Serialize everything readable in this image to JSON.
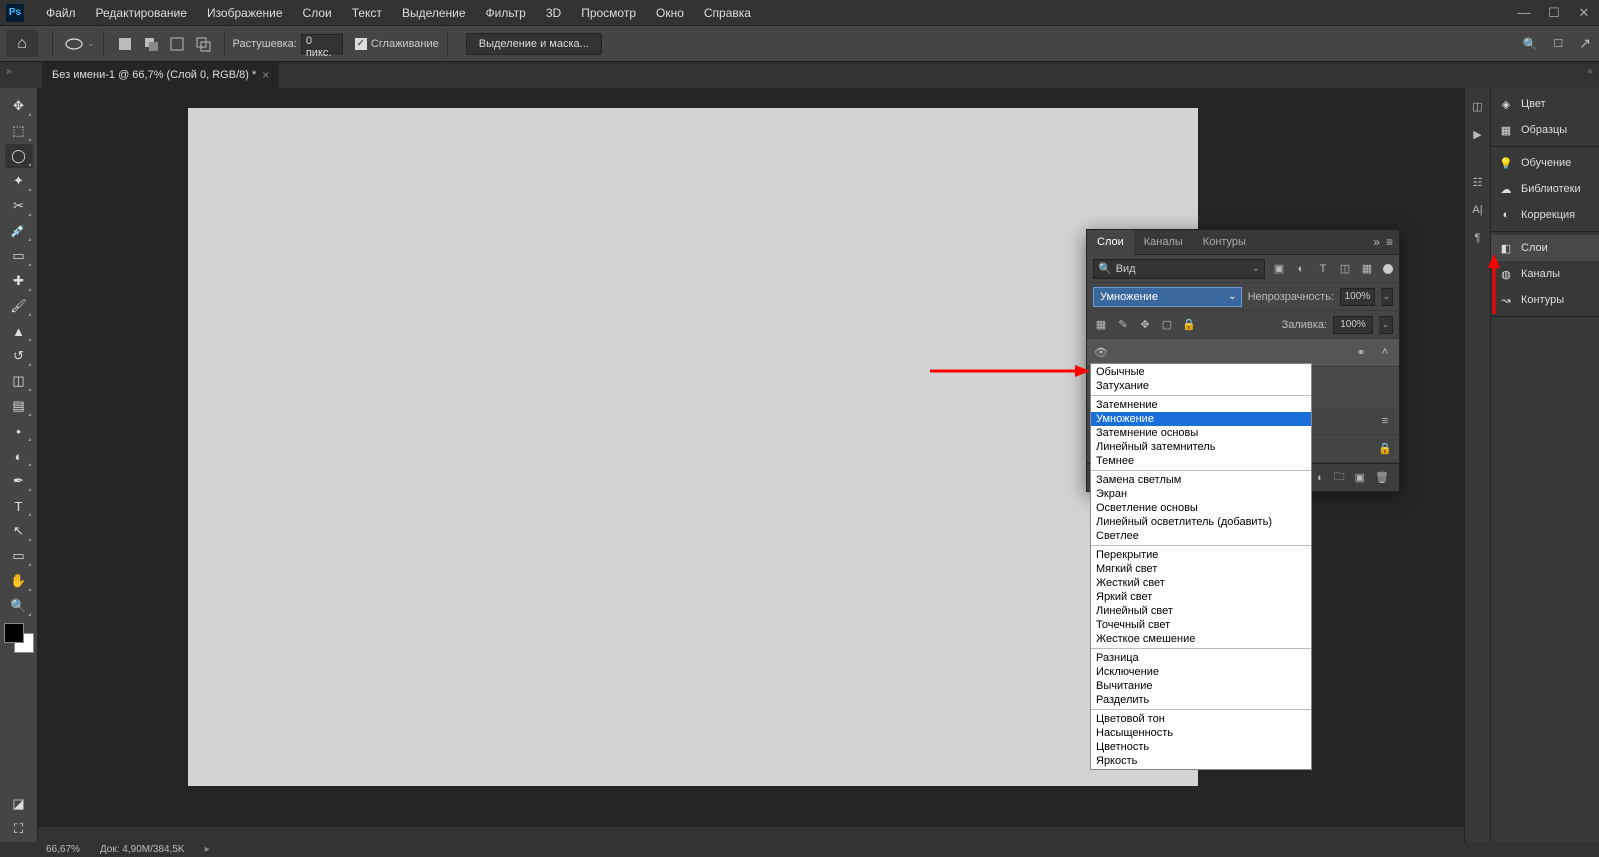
{
  "menubar": {
    "items": [
      "Файл",
      "Редактирование",
      "Изображение",
      "Слои",
      "Текст",
      "Выделение",
      "Фильтр",
      "3D",
      "Просмотр",
      "Окно",
      "Справка"
    ]
  },
  "optbar": {
    "feather_label": "Растушевка:",
    "feather_value": "0 пикс.",
    "antialias_label": "Сглаживание",
    "mask_button": "Выделение и маска..."
  },
  "docTab": {
    "title": "Без имени-1 @ 66,7% (Слой 0, RGB/8) *"
  },
  "rightColumn": {
    "groups": [
      {
        "items": [
          {
            "icon": "color",
            "label": "Цвет"
          },
          {
            "icon": "swatch",
            "label": "Образцы"
          }
        ]
      },
      {
        "items": [
          {
            "icon": "bulb",
            "label": "Обучение"
          },
          {
            "icon": "cc",
            "label": "Библиотеки"
          },
          {
            "icon": "adjust",
            "label": "Коррекция"
          }
        ]
      },
      {
        "items": [
          {
            "icon": "layers",
            "label": "Слои",
            "selected": true
          },
          {
            "icon": "channels",
            "label": "Каналы"
          },
          {
            "icon": "paths",
            "label": "Контуры"
          }
        ]
      }
    ]
  },
  "layersPanel": {
    "tabs": [
      "Слои",
      "Каналы",
      "Контуры"
    ],
    "active_tab": 0,
    "filter_label": "Вид",
    "blend_selected": "Умножение",
    "opacity_label": "Непрозрачность:",
    "opacity_value": "100%",
    "fill_label": "Заливка:",
    "fill_value": "100%",
    "blend_modes": [
      [
        "Обычные",
        "Затухание"
      ],
      [
        "Затемнение",
        "Умножение",
        "Затемнение основы",
        "Линейный затемнитель",
        "Темнее"
      ],
      [
        "Замена светлым",
        "Экран",
        "Осветление основы",
        "Линейный осветлитель (добавить)",
        "Светлее"
      ],
      [
        "Перекрытие",
        "Мягкий свет",
        "Жесткий свет",
        "Яркий свет",
        "Линейный свет",
        "Точечный свет",
        "Жесткое смешение"
      ],
      [
        "Разница",
        "Исключение",
        "Вычитание",
        "Разделить"
      ],
      [
        "Цветовой тон",
        "Насыщенность",
        "Цветность",
        "Яркость"
      ]
    ],
    "highlighted_mode": "Умножение"
  },
  "status": {
    "zoom": "66,67%",
    "doc_info": "Док: 4,90M/384,5K"
  },
  "tools": [
    "move",
    "marquee",
    "lasso",
    "wand",
    "crop",
    "eyedropper",
    "frame",
    "healing",
    "brush",
    "stamp",
    "history",
    "eraser",
    "gradient",
    "blur",
    "dodge",
    "pen",
    "type",
    "path",
    "rectangle",
    "hand",
    "zoom"
  ]
}
